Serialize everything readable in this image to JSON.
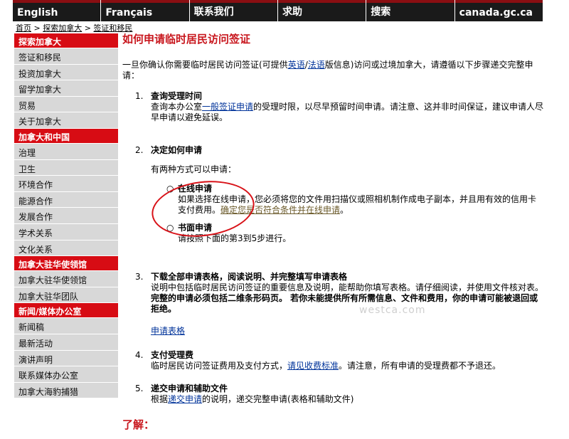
{
  "nav": {
    "items": [
      "English",
      "Français",
      "联系我们",
      "求助",
      "搜索",
      "canada.gc.ca"
    ]
  },
  "breadcrumb": {
    "home": "首页",
    "sep1": " > ",
    "explore": "探索加拿大",
    "sep2": " > ",
    "current": "签证和移民"
  },
  "sidebar": {
    "sections": [
      {
        "heading": "探索加拿大",
        "items": [
          "签证和移民",
          "投资加拿大",
          "留学加拿大",
          "贸易",
          "关于加拿大"
        ]
      },
      {
        "heading": "加拿大和中国",
        "items": [
          "治理",
          "卫生",
          "环境合作",
          "能源合作",
          "发展合作",
          "学术关系",
          "文化关系"
        ]
      },
      {
        "heading": "加拿大驻华使领馆",
        "items": [
          "加拿大驻华使领馆",
          "加拿大驻华团队"
        ]
      },
      {
        "heading": "新闻/媒体办公室",
        "items": [
          "新闻稿",
          "最新活动",
          "演讲声明",
          "联系媒体办公室",
          "加拿大海豹捕猎"
        ]
      }
    ]
  },
  "main": {
    "title": "如何申请临时居民访问签证",
    "intro": {
      "before": "一旦你确认你需要临时居民访问签证(可提供",
      "link1": "英语",
      "slash": "/",
      "link2": "法语",
      "after": "版信息)访问或过境加拿大，请遵循以下步骤递交完整申请："
    },
    "step1": {
      "num": "1.",
      "head": "查询受理时间",
      "before": "查询本办公室",
      "link": "一般签证申请",
      "after": "的受理时限，以尽早预留时间申请。请注意、这并非时间保证，建议申请人尽早申请以避免延误。"
    },
    "step2": {
      "num": "2.",
      "head": "决定如何申请",
      "lead": "有两种方式可以申请：",
      "online": {
        "bullet": "○",
        "head": "在线申请",
        "text": "如果选择在线申请，您必须将您的文件用扫描仪或照相机制作成电子副本，并且用有效的信用卡支付费用。",
        "link": "确定您是否符合条件并在线申请",
        "end": "。"
      },
      "paper": {
        "bullet": "○",
        "head": "书面申请",
        "text": "请按照下面的第3到5步进行。"
      }
    },
    "step3": {
      "num": "3.",
      "head": "下载全部申请表格，阅读说明、并完整填写申请表格",
      "text": "说明中包括临时居民访问签证的重要信息及说明，能帮助你填写表格。请仔细阅读，并使用文件核对表。",
      "bold": "完整的申请必须包括二维条形码页。 若你未能提供所有所需信息、文件和费用，你的申请可能被退回或拒绝。",
      "link": "申请表格"
    },
    "step4": {
      "num": "4.",
      "head": "支付受理费",
      "before": "临时居民访问签证费用及支付方式，",
      "link": "请见收费标准",
      "after": "。请注意，所有申请的受理费都不予退还。"
    },
    "step5": {
      "num": "5.",
      "head": "递交申请和辅助文件",
      "before": "根据",
      "link": "递交申请",
      "after": "的说明，递交完整申请(表格和辅助文件)"
    },
    "more": "了解："
  },
  "watermark": "westca.com",
  "colors": {
    "accent": "#c8161d",
    "sidebar_head": "#d70c14",
    "sidebar_item": "#d8d8d8",
    "topbar": "#1a1a1a",
    "link": "#00339a"
  }
}
